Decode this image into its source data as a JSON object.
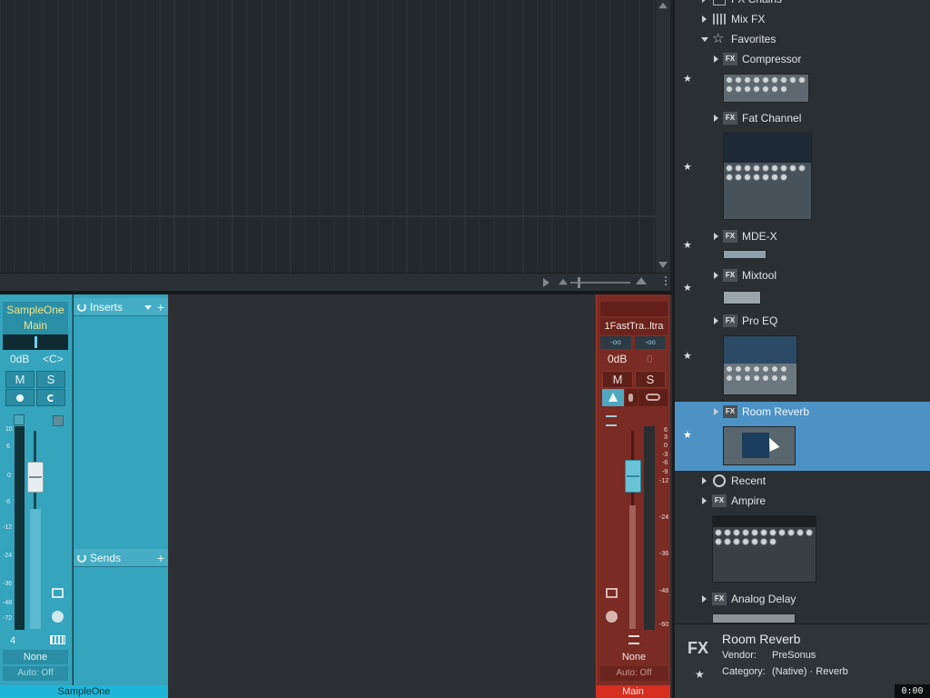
{
  "channel_strip": {
    "name_line1": "SampleOne",
    "name_line2": "Main",
    "volume": "0dB",
    "pan": "<C>",
    "mute": "M",
    "solo": "S",
    "scale": [
      "10",
      "6",
      "0",
      "-6",
      "-12",
      "-24",
      "-36",
      "-48",
      "-72"
    ],
    "number": "4",
    "output": "None",
    "automation": "Auto: Off",
    "label": "SampleOne"
  },
  "inserts": {
    "title": "Inserts"
  },
  "sends": {
    "title": "Sends"
  },
  "main_channel": {
    "name": "1FastTra..ltra",
    "inf_left": "-oo",
    "inf_right": "-oo",
    "volume": "0dB",
    "pan_value": "0",
    "mute": "M",
    "solo": "S",
    "scale": [
      "6",
      "3",
      "0",
      "-3",
      "-6",
      "-9",
      "-12",
      "-24",
      "-36",
      "-48",
      "-60"
    ],
    "output": "None",
    "automation": "Auto: Off",
    "label": "Main"
  },
  "browser": {
    "fx_badge": "FX",
    "top_partial": "FX Chains",
    "mix_fx": "Mix FX",
    "favorites": "Favorites",
    "items": [
      "Compressor",
      "Fat Channel",
      "MDE-X",
      "Mixtool",
      "Pro EQ",
      "Room Reverb"
    ],
    "recent": "Recent",
    "ampire": "Ampire",
    "analog_delay": "Analog Delay",
    "star": "★"
  },
  "info": {
    "fx_icon": "FX",
    "title": "Room Reverb",
    "vendor_label": "Vendor:",
    "vendor": "PreSonus",
    "category_label": "Category:",
    "category": "(Native) · Reverb"
  },
  "time": "0:00",
  "colors": {
    "channel": "#35a4bd",
    "main": "#7a2b24",
    "selection": "#4d92c5"
  }
}
